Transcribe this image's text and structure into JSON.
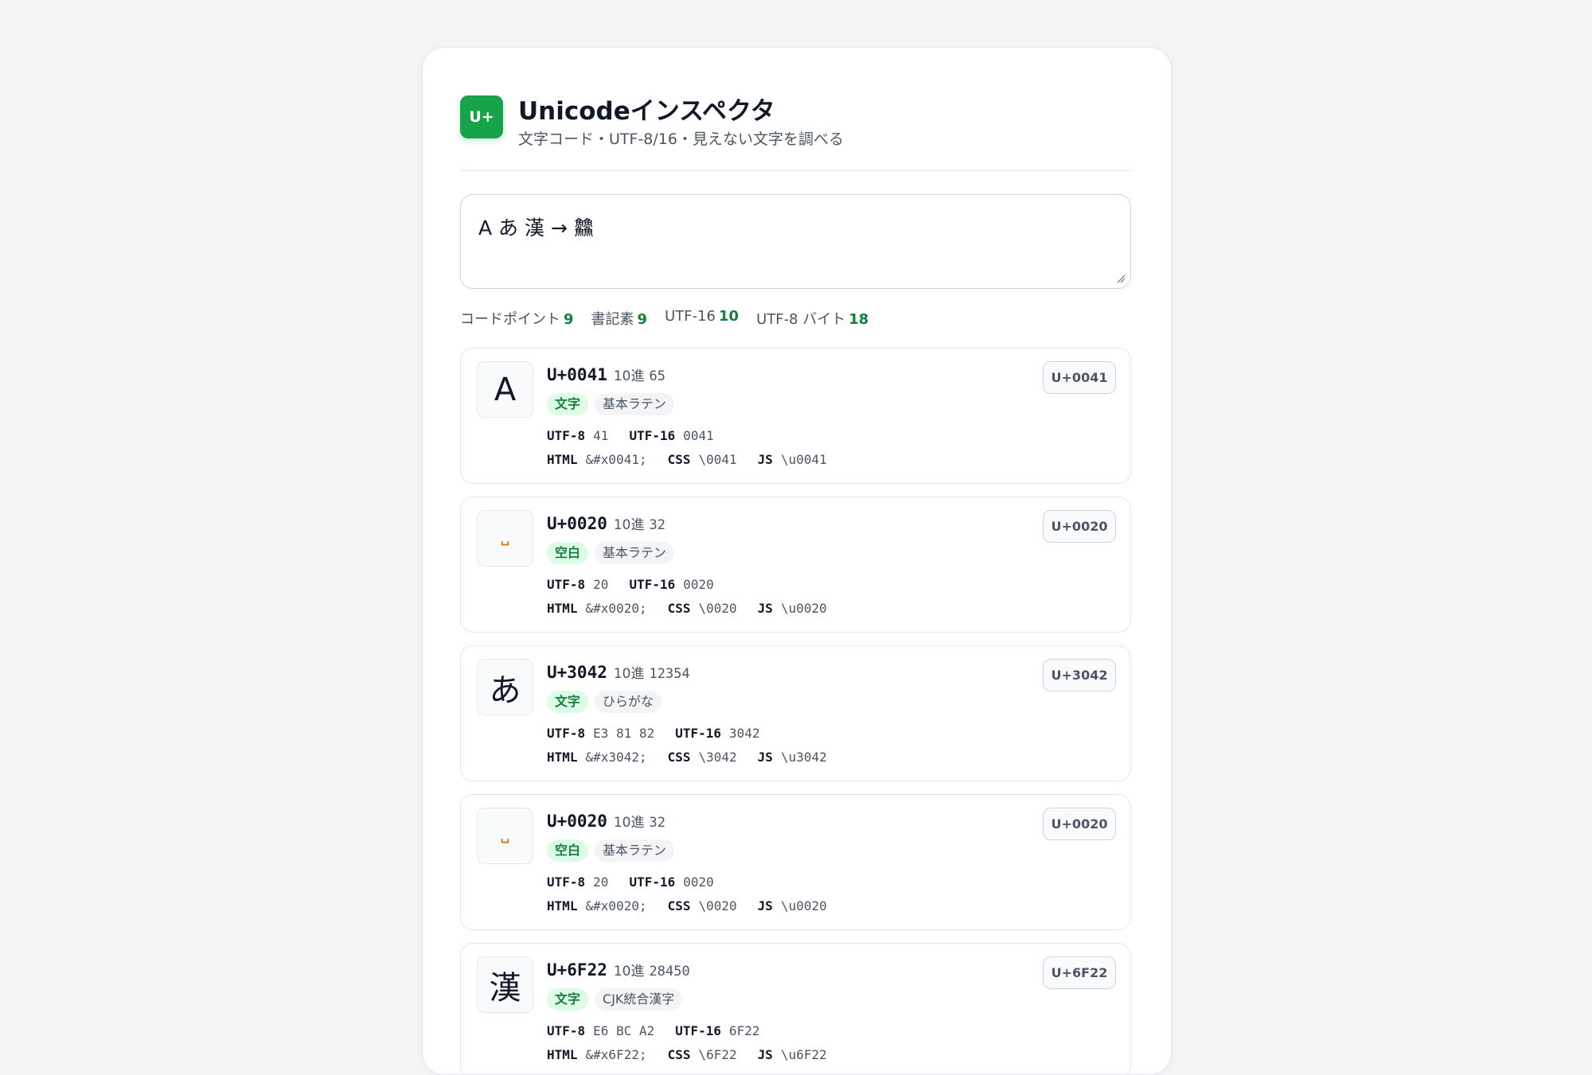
{
  "app": {
    "logo_text": "U+",
    "title": "Unicodeインスペクタ",
    "subtitle": "文字コード・UTF-8/16・見えない文字を調べる"
  },
  "input": {
    "value": "A あ 漢 → 䲜"
  },
  "stats": [
    {
      "label": "コードポイント",
      "value": "9"
    },
    {
      "label": "書記素",
      "value": "9"
    },
    {
      "label": "UTF-16",
      "value": "10"
    },
    {
      "label": "UTF-8 バイト",
      "value": "18"
    }
  ],
  "labels": {
    "decimal": "10進",
    "utf8": "UTF-8",
    "utf16": "UTF-16",
    "html": "HTML",
    "css": "CSS",
    "js": "JS"
  },
  "chars": [
    {
      "glyph": "A",
      "whitespace": false,
      "code": "U+0041",
      "dec": "65",
      "kind": "文字",
      "block": "基本ラテン",
      "utf8": "41",
      "utf16": "0041",
      "html": "&#x0041;",
      "css": "\\0041",
      "js": "\\u0041",
      "copy_label": "U+0041"
    },
    {
      "glyph": "␣",
      "whitespace": true,
      "code": "U+0020",
      "dec": "32",
      "kind": "空白",
      "block": "基本ラテン",
      "utf8": "20",
      "utf16": "0020",
      "html": "&#x0020;",
      "css": "\\0020",
      "js": "\\u0020",
      "copy_label": "U+0020"
    },
    {
      "glyph": "あ",
      "whitespace": false,
      "code": "U+3042",
      "dec": "12354",
      "kind": "文字",
      "block": "ひらがな",
      "utf8": "E3 81 82",
      "utf16": "3042",
      "html": "&#x3042;",
      "css": "\\3042",
      "js": "\\u3042",
      "copy_label": "U+3042"
    },
    {
      "glyph": "␣",
      "whitespace": true,
      "code": "U+0020",
      "dec": "32",
      "kind": "空白",
      "block": "基本ラテン",
      "utf8": "20",
      "utf16": "0020",
      "html": "&#x0020;",
      "css": "\\0020",
      "js": "\\u0020",
      "copy_label": "U+0020"
    },
    {
      "glyph": "漢",
      "whitespace": false,
      "code": "U+6F22",
      "dec": "28450",
      "kind": "文字",
      "block": "CJK統合漢字",
      "utf8": "E6 BC A2",
      "utf16": "6F22",
      "html": "&#x6F22;",
      "css": "\\6F22",
      "js": "\\u6F22",
      "copy_label": "U+6F22"
    }
  ]
}
